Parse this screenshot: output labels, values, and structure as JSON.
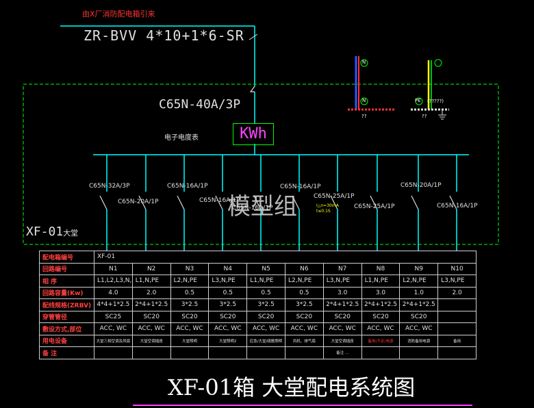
{
  "header": {
    "source_text": "由X厂消防配电箱引来",
    "cable_spec": "ZR-BVV  4*10+1*6-SR"
  },
  "main_breaker": "C65N-40A/3P",
  "meter": {
    "label": "电子电度表",
    "symbol": "KWh"
  },
  "box_label": {
    "code": "XF-01",
    "suffix": "大堂"
  },
  "watermark": "模型组",
  "ground_terminals": {
    "n_label": "N",
    "pe_label": "PE",
    "pe_note": "(?????)",
    "q1": "??",
    "q2": "??"
  },
  "branch_breakers": [
    "C65N-32A/3P",
    "C65N-20A/1P",
    "C65N-16A/1P",
    "C65N-16A/1P",
    "C65N-16A/1P",
    "C65N-16A/1P",
    "C65N-25A/1P",
    "C65N-25A/1P",
    "C65N-20A/1P",
    "C65N-16A/1P"
  ],
  "rcd_label": [
    "I△n=30mA",
    "t≤0.1S"
  ],
  "table": {
    "row_headers": [
      "配电箱编号",
      "回路编号",
      "相  序",
      "回路容量(Kw)",
      "配线规格(ZRBV)",
      "穿管管径",
      "敷设方式,部位",
      "用电设备",
      "备  注"
    ],
    "box_no": "XF-01",
    "circuits": [
      "N1",
      "N2",
      "N3",
      "N4",
      "N5",
      "N6",
      "N7",
      "N8",
      "N9",
      "N10"
    ],
    "phases": [
      "L1,L2,L3,N,PE",
      "L1,N,PE",
      "L2,N,PE",
      "L3,N,PE",
      "L1,N,PE",
      "L2,N,PE",
      "L3,N,PE",
      "L1,N,PE",
      "L2,N,PE",
      "L3,N,PE"
    ],
    "capacity": [
      "4.0",
      "2.0",
      "0.5",
      "0.5",
      "0.5",
      "0.5",
      "3.0",
      "3.0",
      "1.0",
      "2.0"
    ],
    "wiring": [
      "4*4+1*2.5",
      "2*4+1*2.5",
      "3*2.5",
      "3*2.5",
      "3*2.5",
      "3*2.5",
      "2*4+1*2.5",
      "2*4+1*2.5",
      "2*4+1*2.5",
      ""
    ],
    "conduit": [
      "SC25",
      "SC20",
      "SC20",
      "SC20",
      "SC20",
      "SC20",
      "SC20",
      "SC20",
      "SC20",
      ""
    ],
    "laying": [
      "ACC, WC",
      "ACC, WC",
      "ACC, WC",
      "ACC, WC",
      "ACC, WC",
      "ACC, WC",
      "ACC, WC",
      "ACC, WC",
      "ACC, WC",
      ""
    ],
    "devices": [
      "大堂三相空调及风扇",
      "大堂空调插座",
      "大堂照明",
      "大堂照明2",
      "应急/大堂/疏散照明",
      "风机、排气扇",
      "大堂空调插座",
      "备用(不足)电源",
      "消防备用电源",
      "备用"
    ],
    "remarks": [
      "",
      "",
      "",
      "",
      "",
      "",
      "备注 ...",
      "",
      "",
      ""
    ]
  },
  "title": "XF-01箱  大堂配电系统图",
  "colors": {
    "background": "#000000",
    "line": "#00ffff",
    "frame": "#00ff00",
    "red": "#ff3333",
    "white": "#e0e0e0",
    "blue": "#3355ff",
    "yellow": "#ffff00",
    "magenta": "#ff44ff"
  }
}
